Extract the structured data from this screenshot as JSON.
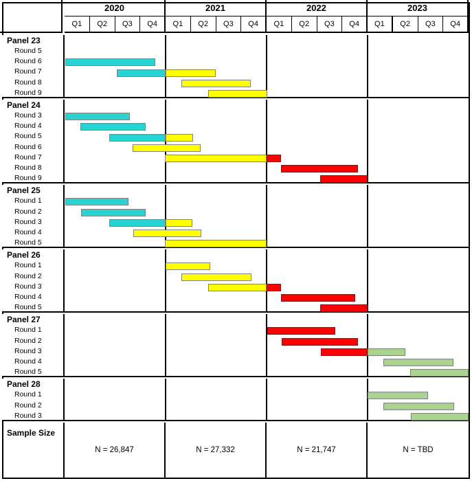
{
  "meta": {
    "title": "Panel Data Collection Timeline Gantt Chart",
    "colors": {
      "cyan": "#29D3D3",
      "yellow": "#FFFF00",
      "red": "#FF0000",
      "green": "#AAD390",
      "border": "#000000"
    }
  },
  "header": {
    "corner_label": "",
    "years": [
      "2020",
      "2021",
      "2022",
      "2023"
    ],
    "quarters": [
      "Q1",
      "Q2",
      "Q3",
      "Q4"
    ],
    "quarter_row": [
      "Q1",
      "Q2",
      "Q3",
      "Q4",
      "Q1",
      "Q2",
      "Q3",
      "Q4",
      "Q1",
      "Q2",
      "Q3",
      "Q4",
      "Q1",
      "Q2",
      "Q3",
      "Q4"
    ]
  },
  "panels": [
    {
      "title": "Panel 23",
      "rows": [
        {
          "label": "Round 5",
          "bars": []
        },
        {
          "label": "Round 6",
          "bars": [
            {
              "color": "cyan",
              "start": 0.02,
              "end": 3.6
            }
          ]
        },
        {
          "label": "Round 7",
          "bars": [
            {
              "color": "cyan",
              "start": 2.06,
              "end": 4.0
            },
            {
              "color": "yellow",
              "start": 4.0,
              "end": 5.98
            }
          ]
        },
        {
          "label": "Round 8",
          "bars": [
            {
              "color": "yellow",
              "start": 4.62,
              "end": 7.38
            }
          ]
        },
        {
          "label": "Round 9",
          "bars": [
            {
              "color": "yellow",
              "start": 5.68,
              "end": 8.02
            }
          ]
        }
      ]
    },
    {
      "title": "Panel 24",
      "rows": [
        {
          "label": "Round 3",
          "bars": [
            {
              "color": "cyan",
              "start": 0.02,
              "end": 2.58
            }
          ]
        },
        {
          "label": "Round 4",
          "bars": [
            {
              "color": "cyan",
              "start": 0.62,
              "end": 3.22
            }
          ]
        },
        {
          "label": "Round 5",
          "bars": [
            {
              "color": "cyan",
              "start": 1.78,
              "end": 4.0
            },
            {
              "color": "yellow",
              "start": 4.0,
              "end": 5.1
            }
          ]
        },
        {
          "label": "Round 6",
          "bars": [
            {
              "color": "yellow",
              "start": 2.7,
              "end": 5.4
            }
          ]
        },
        {
          "label": "Round 7",
          "bars": [
            {
              "color": "yellow",
              "start": 3.96,
              "end": 8.0
            },
            {
              "color": "red",
              "start": 8.0,
              "end": 8.58
            }
          ]
        },
        {
          "label": "Round 8",
          "bars": [
            {
              "color": "red",
              "start": 8.58,
              "end": 11.62
            }
          ]
        },
        {
          "label": "Round 9",
          "bars": [
            {
              "color": "red",
              "start": 10.12,
              "end": 12.0
            }
          ]
        }
      ]
    },
    {
      "title": "Panel 25",
      "rows": [
        {
          "label": "Round 1",
          "bars": [
            {
              "color": "cyan",
              "start": 0.02,
              "end": 2.52
            }
          ]
        },
        {
          "label": "Round 2",
          "bars": [
            {
              "color": "cyan",
              "start": 0.64,
              "end": 3.22
            }
          ]
        },
        {
          "label": "Round 3",
          "bars": [
            {
              "color": "cyan",
              "start": 1.78,
              "end": 4.0
            },
            {
              "color": "yellow",
              "start": 4.0,
              "end": 5.06
            }
          ]
        },
        {
          "label": "Round 4",
          "bars": [
            {
              "color": "yellow",
              "start": 2.72,
              "end": 5.42
            }
          ]
        },
        {
          "label": "Round 5",
          "bars": [
            {
              "color": "yellow",
              "start": 3.96,
              "end": 8.0
            }
          ]
        }
      ]
    },
    {
      "title": "Panel 26",
      "rows": [
        {
          "label": "Round 1",
          "bars": [
            {
              "color": "yellow",
              "start": 4.0,
              "end": 5.78
            }
          ]
        },
        {
          "label": "Round 2",
          "bars": [
            {
              "color": "yellow",
              "start": 4.62,
              "end": 7.4
            }
          ]
        },
        {
          "label": "Round 3",
          "bars": [
            {
              "color": "yellow",
              "start": 5.68,
              "end": 8.0
            },
            {
              "color": "red",
              "start": 8.0,
              "end": 8.58
            }
          ]
        },
        {
          "label": "Round 4",
          "bars": [
            {
              "color": "red",
              "start": 8.58,
              "end": 11.5
            }
          ]
        },
        {
          "label": "Round 5",
          "bars": [
            {
              "color": "red",
              "start": 10.12,
              "end": 12.0
            }
          ]
        }
      ]
    },
    {
      "title": "Panel 27",
      "rows": [
        {
          "label": "Round 1",
          "bars": [
            {
              "color": "red",
              "start": 8.02,
              "end": 10.72
            }
          ]
        },
        {
          "label": "Round 2",
          "bars": [
            {
              "color": "red",
              "start": 8.6,
              "end": 11.62
            }
          ]
        },
        {
          "label": "Round 3",
          "bars": [
            {
              "color": "red",
              "start": 10.14,
              "end": 12.0
            },
            {
              "color": "green",
              "start": 12.0,
              "end": 13.5
            }
          ]
        },
        {
          "label": "Round 4",
          "bars": [
            {
              "color": "green",
              "start": 12.62,
              "end": 15.4
            }
          ]
        },
        {
          "label": "Round 5",
          "bars": [
            {
              "color": "green",
              "start": 13.7,
              "end": 16.0
            }
          ]
        }
      ]
    },
    {
      "title": "Panel 28",
      "rows": [
        {
          "label": "Round 1",
          "bars": [
            {
              "color": "green",
              "start": 12.0,
              "end": 14.4
            }
          ]
        },
        {
          "label": "Round 2",
          "bars": [
            {
              "color": "green",
              "start": 12.62,
              "end": 15.42
            }
          ]
        },
        {
          "label": "Round 3",
          "bars": [
            {
              "color": "green",
              "start": 13.72,
              "end": 16.0
            }
          ]
        }
      ]
    }
  ],
  "footer": {
    "label": "Sample Size",
    "cells": [
      "N = 26,847",
      "N = 27,332",
      "N = 21,747",
      "N = TBD"
    ]
  }
}
